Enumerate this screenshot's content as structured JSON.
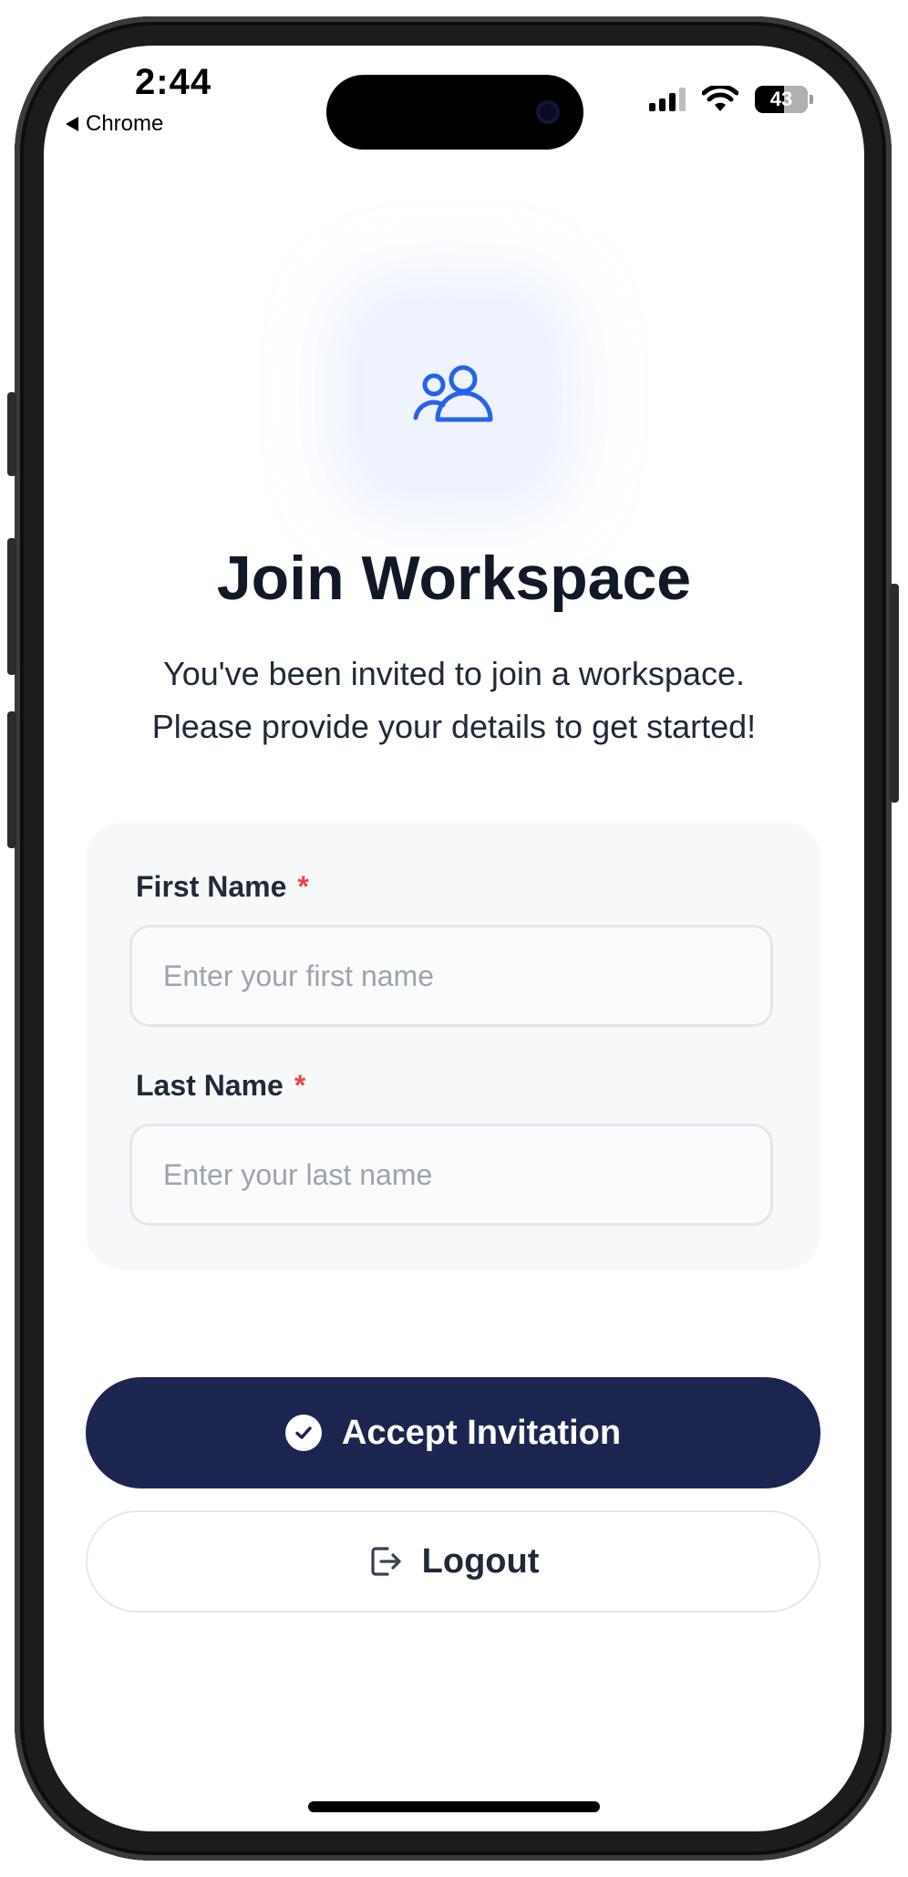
{
  "status_bar": {
    "time": "2:44",
    "back_app": "Chrome",
    "battery": "43"
  },
  "hero": {
    "icon": "users-icon",
    "title": "Join Workspace",
    "subtitle_line1": "You've been invited to join a workspace.",
    "subtitle_line2": "Please provide your details to get started!"
  },
  "form": {
    "first_name": {
      "label": "First Name",
      "required_mark": "*",
      "value": "",
      "placeholder": "Enter your first name"
    },
    "last_name": {
      "label": "Last Name",
      "required_mark": "*",
      "value": "",
      "placeholder": "Enter your last name"
    }
  },
  "actions": {
    "accept_label": "Accept Invitation",
    "accept_icon": "check-circle-icon",
    "logout_label": "Logout",
    "logout_icon": "logout-icon"
  },
  "colors": {
    "accent": "#2563eb",
    "primary_button": "#1b2550",
    "required": "#ef4444",
    "title": "#111827"
  }
}
